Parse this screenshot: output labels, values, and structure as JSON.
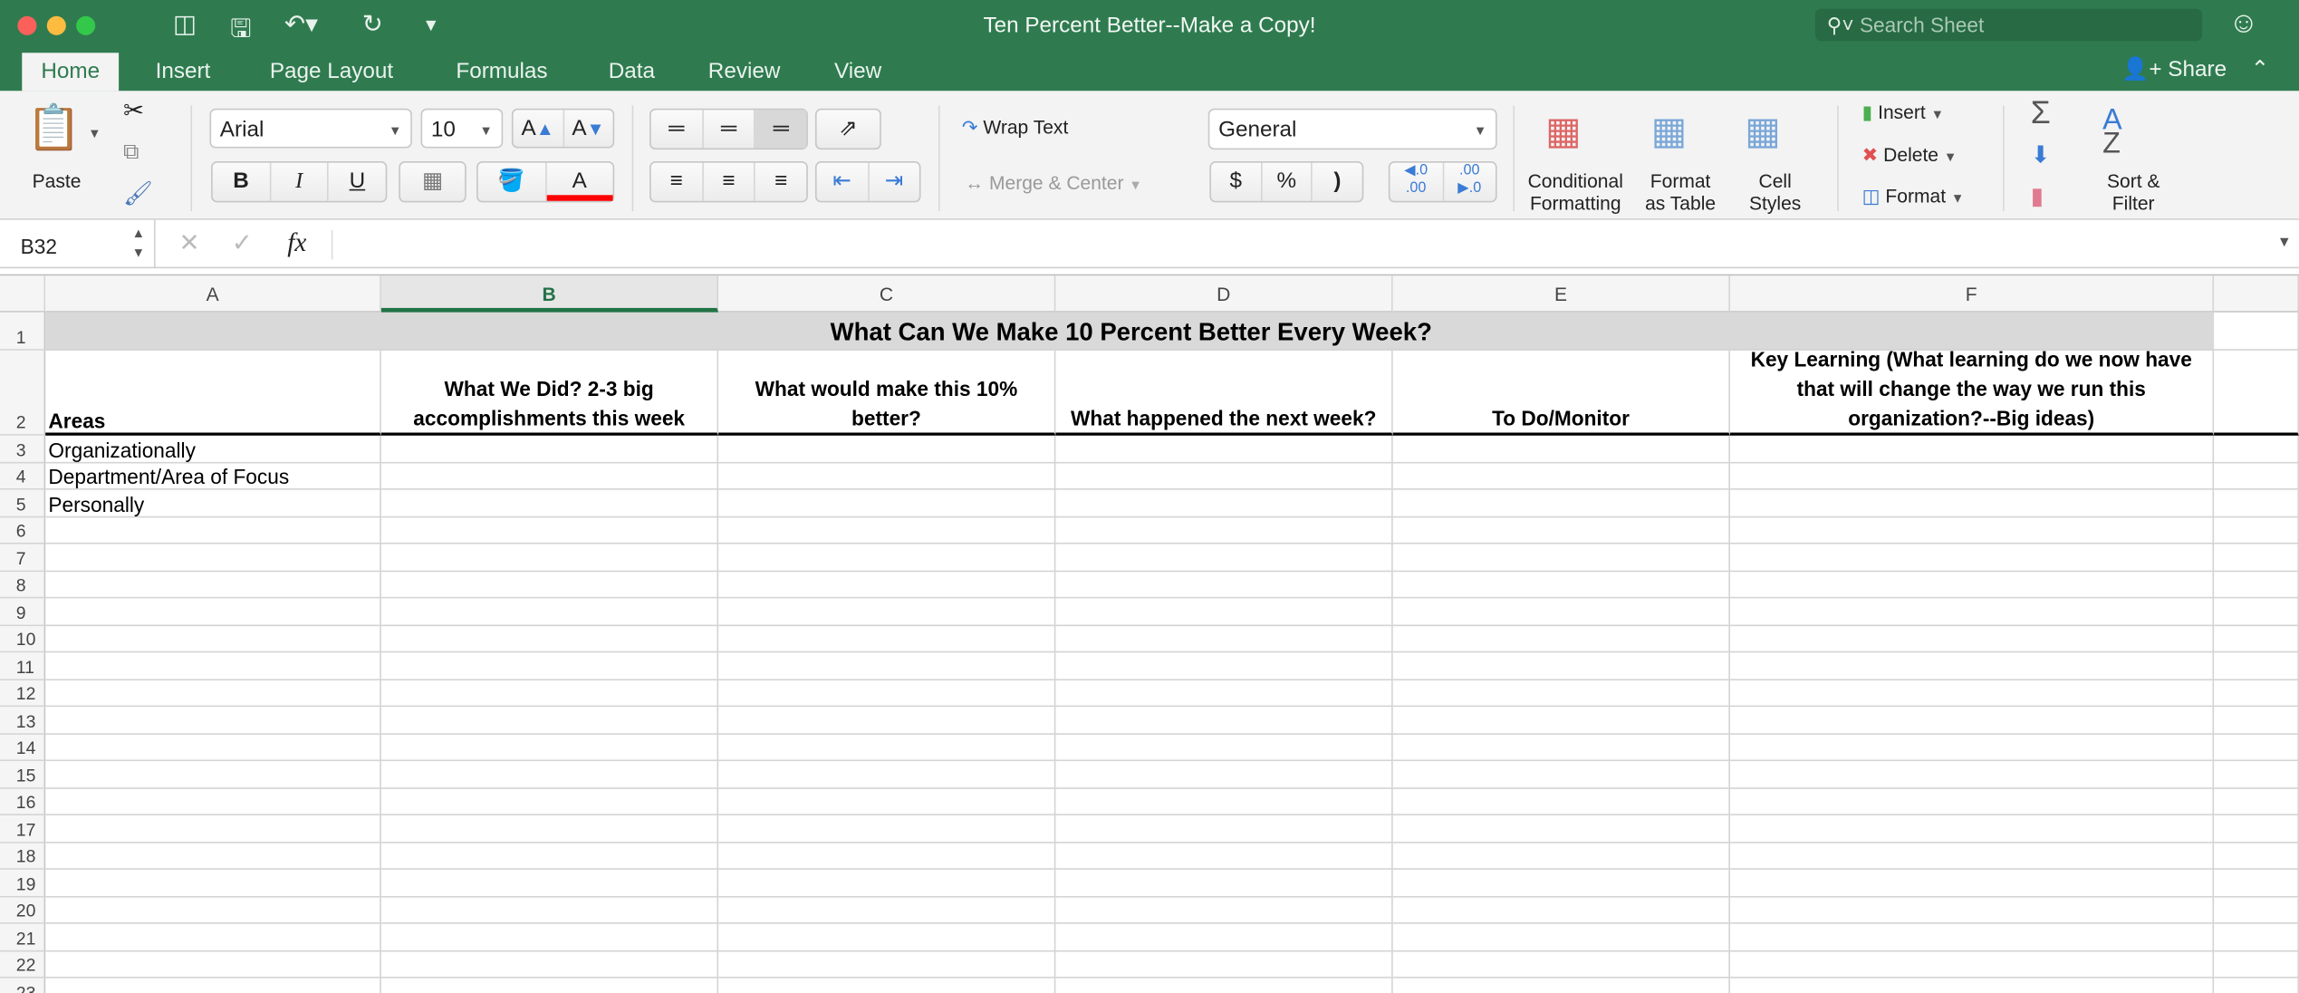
{
  "window": {
    "title": "Ten Percent Better--Make a Copy!",
    "search_placeholder": "Search Sheet",
    "share": "Share"
  },
  "tabs": [
    "Home",
    "Insert",
    "Page Layout",
    "Formulas",
    "Data",
    "Review",
    "View"
  ],
  "ribbon": {
    "paste": "Paste",
    "font": "Arial",
    "size": "10",
    "wrap_text": "Wrap Text",
    "merge_center": "Merge & Center",
    "number_format": "General",
    "currency": "$",
    "percent": "%",
    "comma": ")",
    "conditional_formatting": [
      "Conditional",
      "Formatting"
    ],
    "format_as_table": [
      "Format",
      "as Table"
    ],
    "cell_styles": [
      "Cell",
      "Styles"
    ],
    "insert": "Insert",
    "delete": "Delete",
    "format": "Format",
    "sort_filter": [
      "Sort &",
      "Filter"
    ],
    "bold": "B",
    "italic": "I",
    "underline": "U",
    "font_color_swatch": "#ff0000"
  },
  "formula_bar": {
    "name_box": "B32",
    "fx": "fx",
    "value": ""
  },
  "sheet": {
    "columns": [
      "A",
      "B",
      "C",
      "D",
      "E",
      "F"
    ],
    "selected_column": "B",
    "title": "What Can We Make 10 Percent Better Every Week?",
    "headers": [
      "Areas",
      "What We Did? 2-3 big accomplishments this week",
      "What would make this 10% better?",
      "What happened the next week?",
      "To Do/Monitor",
      "Key Learning (What learning do we now have that will change the way we run this organization?--Big ideas)"
    ],
    "row_labels": [
      "Organizationally",
      "Department/Area of Focus",
      "Personally"
    ],
    "row_numbers": [
      "1",
      "2",
      "3",
      "4",
      "5",
      "6",
      "7",
      "8",
      "9",
      "10",
      "11",
      "12",
      "13",
      "14",
      "15",
      "16",
      "17",
      "18",
      "19",
      "20",
      "21",
      "22",
      "23"
    ]
  }
}
